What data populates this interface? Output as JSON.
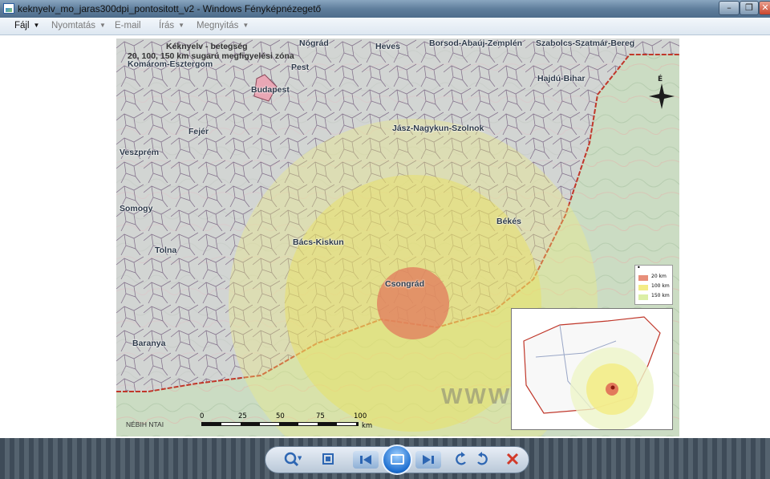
{
  "window": {
    "title": "keknyelv_mo_jaras300dpi_pontositott_v2 - Windows Fényképnézegető",
    "minimize": "–",
    "maximize": "❐",
    "close": "✕"
  },
  "menu": {
    "items": [
      {
        "label": "Fájl",
        "active": true
      },
      {
        "label": "Nyomtatás",
        "active": false
      },
      {
        "label": "E-mail",
        "active": false
      },
      {
        "label": "Írás",
        "active": false
      },
      {
        "label": "Megnyitás",
        "active": false
      }
    ]
  },
  "map": {
    "title_line1": "Kéknyelv - betegség",
    "title_line2": "20, 100, 150 km sugarú megfigyelési zóna",
    "counties": {
      "nograd": "Nógrád",
      "heves": "Heves",
      "borsod": "Borsod-Abaúj-Zemplén",
      "szabolcs": "Szabolcs-Szatmár-Bereg",
      "komarom": "Komárom-Esztergom",
      "pest": "Pest",
      "budapest": "Budapest",
      "hajdu": "Hajdú-Bihar",
      "fejer": "Fejér",
      "jasz": "Jász-Nagykun-Szolnok",
      "veszprem": "Veszprém",
      "somogy": "Somogy",
      "bekes": "Békés",
      "bacs": "Bács-Kiskun",
      "tolna": "Tolna",
      "csongrad": "Csongrád",
      "baranya": "Baranya"
    },
    "north_label": "É",
    "watermark": "WWW",
    "credit": "NÉBIH NTAI",
    "scale": {
      "ticks": [
        "0",
        "25",
        "50",
        "75",
        "100"
      ],
      "unit": "km"
    },
    "legend": [
      {
        "label": "20 km",
        "color": "#e88f7a"
      },
      {
        "label": "100 km",
        "color": "#f3ec86"
      },
      {
        "label": "150 km",
        "color": "#dcefa6"
      }
    ],
    "legend_header": "•"
  },
  "toolbar": {
    "zoom_icon": "search-icon",
    "fit_icon": "fit-icon",
    "prev_icon": "previous-icon",
    "slideshow_icon": "slideshow-icon",
    "next_icon": "next-icon",
    "rotate_ccw_icon": "rotate-left-icon",
    "rotate_cw_icon": "rotate-right-icon",
    "delete_icon": "delete-icon"
  }
}
